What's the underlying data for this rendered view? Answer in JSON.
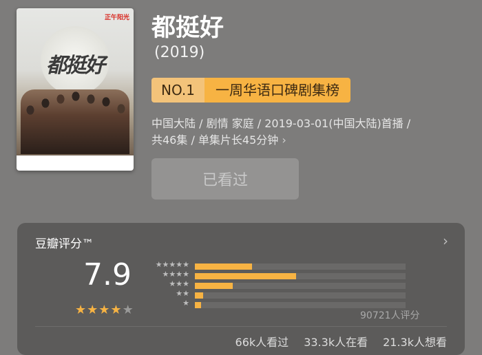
{
  "movie": {
    "title": "都挺好",
    "year": "(2019)",
    "rank_badge": {
      "number": "NO.1",
      "label": "一周华语口碑剧集榜"
    },
    "meta_line1": "中国大陆 / 剧情 家庭 / 2019-03-01(中国大陆)首播 /",
    "meta_line2": "共46集 / 单集片长45分钟",
    "watched_button": "已看过",
    "poster": {
      "title": "都挺好",
      "brand": "正午阳光"
    }
  },
  "rating": {
    "header": "豆瓣评分™",
    "score": "7.9",
    "stars_filled": 4,
    "stars_total": 5,
    "distribution": [
      {
        "stars": "★★★★★",
        "fraction": 0.27
      },
      {
        "stars": "★★★★",
        "fraction": 0.48
      },
      {
        "stars": "★★★",
        "fraction": 0.18
      },
      {
        "stars": "★★",
        "fraction": 0.04
      },
      {
        "stars": "★",
        "fraction": 0.03
      }
    ],
    "count_label": "90721人评分",
    "stats": [
      "66k人看过",
      "33.3k人在看",
      "21.3k人想看"
    ]
  },
  "colors": {
    "accent": "#f7b343",
    "badge_no": "#f3c37a",
    "background": "#7d7c7b",
    "card": "#5c5b5a"
  }
}
